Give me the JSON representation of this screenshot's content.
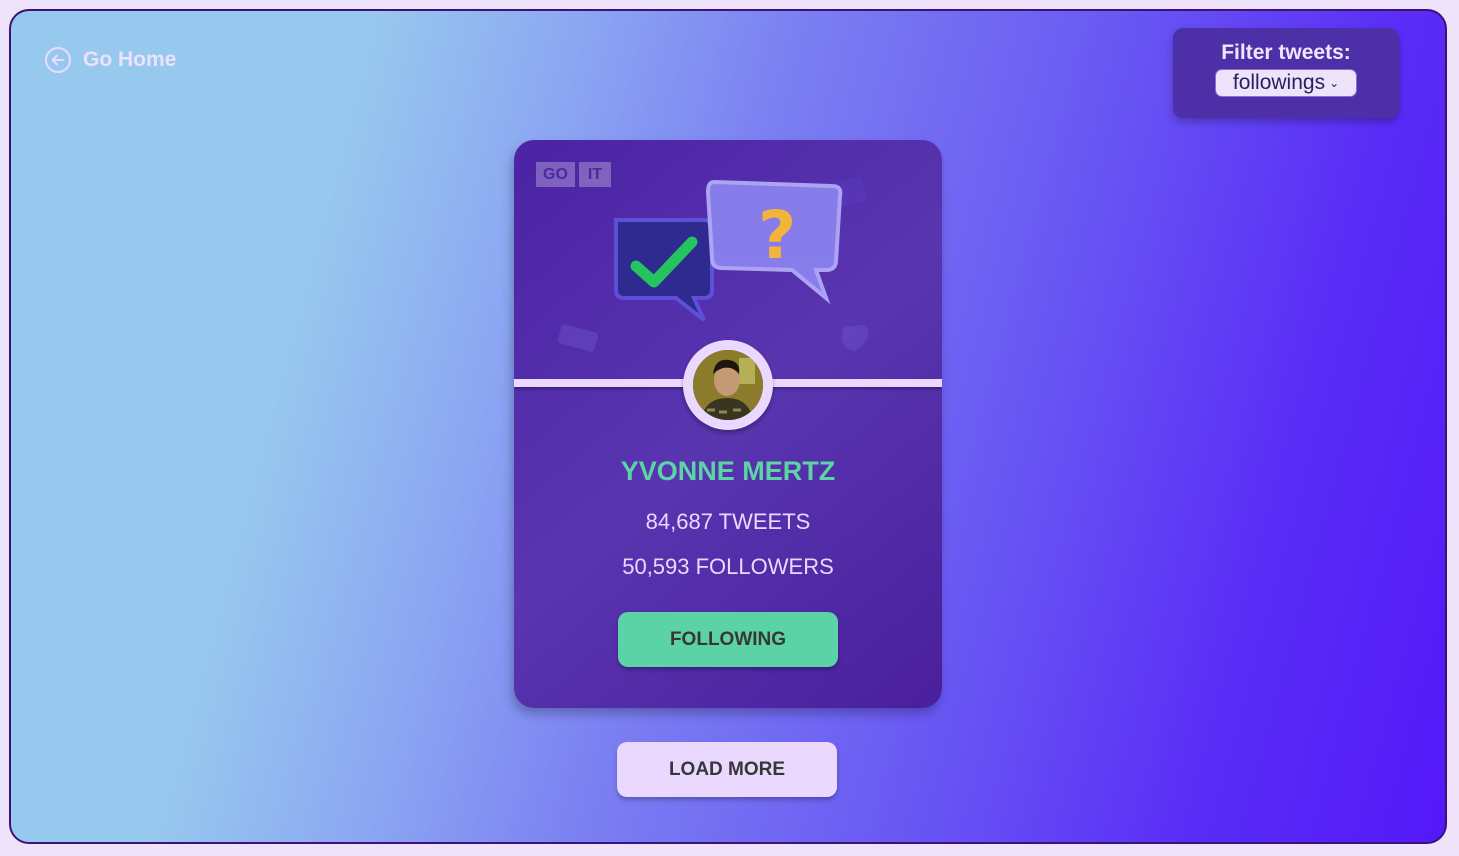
{
  "nav": {
    "go_home_label": "Go Home"
  },
  "filter": {
    "label": "Filter tweets:",
    "selected": "followings"
  },
  "card": {
    "logo_left": "GO",
    "logo_right": "IT",
    "name": "YVONNE MERTZ",
    "tweets": "84,687 TWEETS",
    "followers": "50,593 FOLLOWERS",
    "follow_button_label": "FOLLOWING"
  },
  "load_more_label": "LOAD MORE",
  "colors": {
    "accent_green": "#5cd3a6",
    "card_purple": "#4b23a4",
    "light_lavender": "#ebd8ff"
  }
}
